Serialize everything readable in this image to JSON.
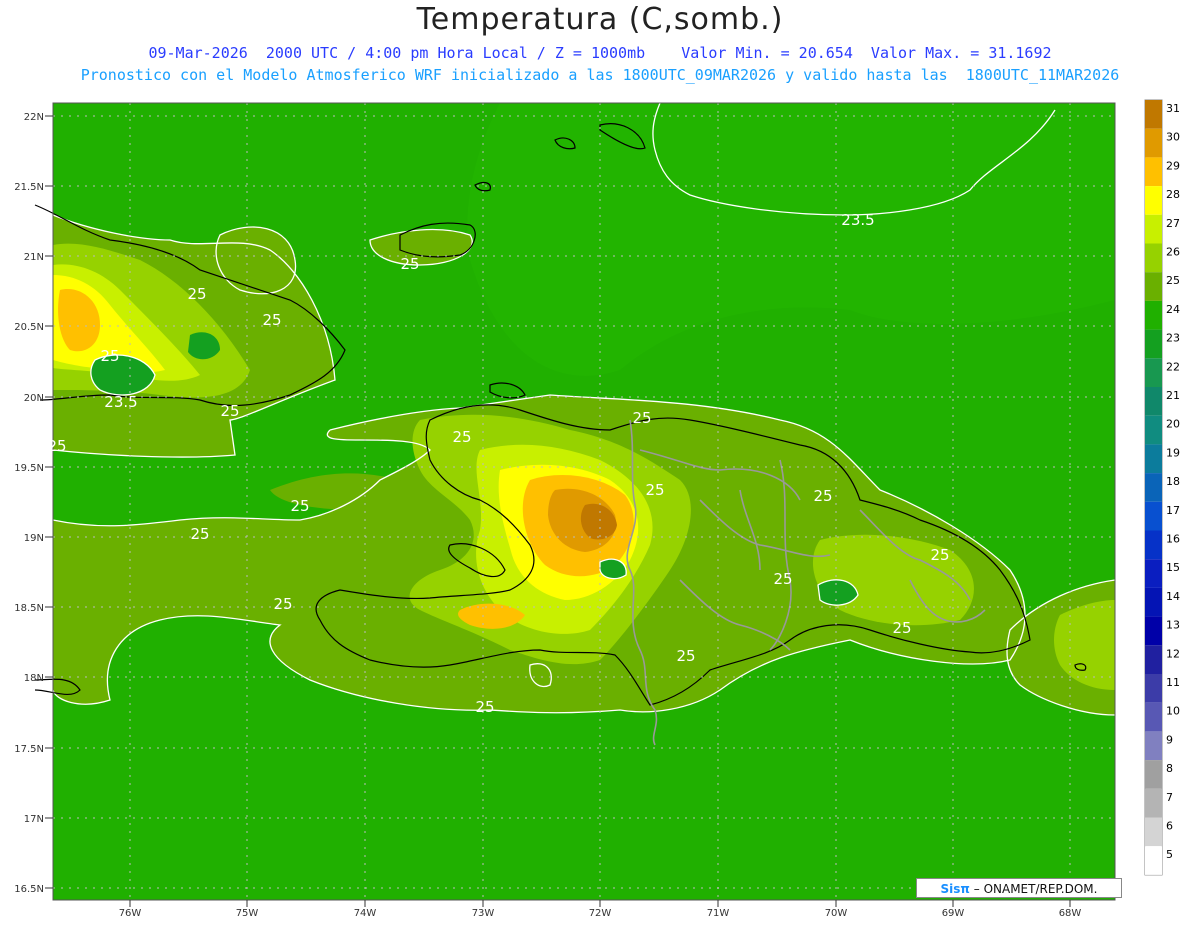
{
  "title": "Temperatura (C,somb.)",
  "subtitle_line1": "09-Mar-2026  2000 UTC / 4:00 pm Hora Local / Z = 1000mb    Valor Min. = 20.654  Valor Max. = 31.1692",
  "subtitle_line2": "Pronostico con el Modelo Atmosferico WRF inicializado a las 1800UTC_09MAR2026 y valido hasta las  1800UTC_11MAR2026",
  "credit": {
    "brand": "Sisπ",
    "text": "– ONAMET/REP.DOM."
  },
  "axes": {
    "lat_labels": [
      "22N",
      "21.5N",
      "21N",
      "20.5N",
      "20N",
      "19.5N",
      "19N",
      "18.5N",
      "18N",
      "17.5N",
      "17N",
      "16.5N"
    ],
    "lon_labels": [
      "76W",
      "75W",
      "74W",
      "73W",
      "72W",
      "71W",
      "70W",
      "69W",
      "68W"
    ]
  },
  "contour_labels": [
    "23.5",
    "25",
    "25",
    "25",
    "25",
    "23.5",
    "25",
    "25",
    "25",
    "25",
    "25",
    "25",
    "25",
    "25",
    "25",
    "25",
    "25",
    "25",
    "25",
    "25"
  ],
  "colorbar": {
    "levels": [
      "31",
      "30",
      "29",
      "28",
      "27",
      "26",
      "25",
      "24",
      "23",
      "22",
      "21",
      "20",
      "19",
      "18",
      "17",
      "16",
      "15",
      "14",
      "13",
      "12",
      "11",
      "10",
      "9",
      "8",
      "7",
      "6",
      "5"
    ],
    "colors": [
      "#c07800",
      "#e09a00",
      "#ffc000",
      "#ffff00",
      "#c8f000",
      "#96d200",
      "#6ab000",
      "#20b000",
      "#14a020",
      "#189850",
      "#10886a",
      "#108c80",
      "#0c7c9c",
      "#0a64b8",
      "#0850d0",
      "#0632c8",
      "#0a1ec0",
      "#0414b4",
      "#0000a8",
      "#2020a0",
      "#3c3ca8",
      "#5858b4",
      "#8080c0",
      "#a0a0a0",
      "#b4b4b4",
      "#d4d4d4",
      "#ffffff"
    ]
  }
}
